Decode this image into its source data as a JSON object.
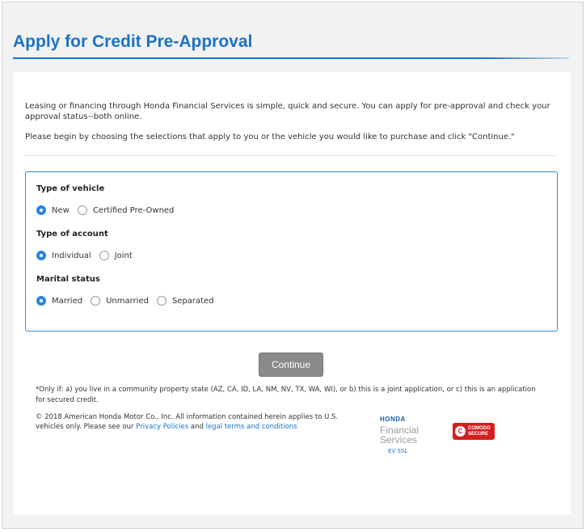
{
  "page": {
    "title": "Apply for Credit Pre-Approval",
    "intro_1": "Leasing or financing through Honda Financial Services is simple, quick and secure. You can apply for pre-approval and check your approval status--both online.",
    "intro_2": "Please begin by choosing the selections that apply to you or the vehicle you would like to purchase and click \"Continue.\""
  },
  "form": {
    "vehicle": {
      "label": "Type of vehicle",
      "options": [
        {
          "label": "New",
          "selected": true
        },
        {
          "label": "Certified Pre-Owned",
          "selected": false
        }
      ]
    },
    "account": {
      "label": "Type of account",
      "options": [
        {
          "label": "Individual",
          "selected": true
        },
        {
          "label": "Joint",
          "selected": false
        }
      ]
    },
    "marital": {
      "label": "Marital status",
      "options": [
        {
          "label": "Married",
          "selected": true
        },
        {
          "label": "Unmarried",
          "selected": false
        },
        {
          "label": "Separated",
          "selected": false
        }
      ]
    },
    "continue_label": "Continue"
  },
  "footer": {
    "footnote": "*Only if: a) you live in a community property state (AZ, CA, ID, LA, NM, NV, TX, WA, WI), or b) this is a joint application, or c) this is an application for secured credit.",
    "copyright_prefix": "© 2018 American Honda Motor Co., Inc. All information contained herein applies to U.S. vehicles only. Please see our",
    "privacy_link": "Privacy Policies",
    "and_text": "and",
    "terms_link": "legal terms and conditions",
    "hfs_brand": "HONDA",
    "hfs_line1": "Financial",
    "hfs_line2": "Services",
    "ev_ssl": "EV SSL",
    "comodo_line1": "COMODO",
    "comodo_line2": "SECURE",
    "comodo_seal": "C"
  },
  "colors": {
    "accent": "#1a73c7",
    "radio_checked": "#2d84e0",
    "button": "#8a8a8a",
    "comodo_red": "#d41f1f"
  }
}
